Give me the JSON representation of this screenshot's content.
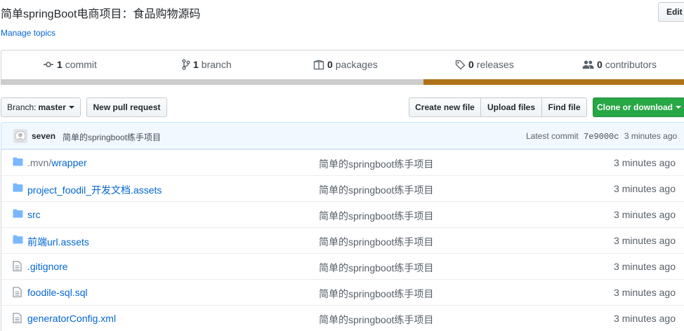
{
  "repo": {
    "description": "简单springBoot电商项目：食品购物源码",
    "manage_topics": "Manage topics",
    "edit_label": "Edit"
  },
  "summary": {
    "commits": {
      "count": "1",
      "label": "commit",
      "icon": "commit-icon"
    },
    "branches": {
      "count": "1",
      "label": "branch",
      "icon": "branch-icon"
    },
    "packages": {
      "count": "0",
      "label": "packages",
      "icon": "package-icon"
    },
    "releases": {
      "count": "0",
      "label": "releases",
      "icon": "tag-icon"
    },
    "contributors": {
      "count": "0",
      "label": "contributors",
      "icon": "people-icon"
    },
    "language_colors": [
      "#cccccc",
      "#b07219"
    ]
  },
  "toolbar": {
    "branch_prefix": "Branch:",
    "branch_name": "master",
    "new_pull_request": "New pull request",
    "create_new_file": "Create new file",
    "upload_files": "Upload files",
    "find_file": "Find file",
    "clone_or_download": "Clone or download",
    "clone_color": "#28a745"
  },
  "latest_commit": {
    "author": "seven",
    "message": "简单的springboot练手项目",
    "prefix": "Latest commit",
    "sha": "7e9000c",
    "age": "3 minutes ago"
  },
  "files": [
    {
      "type": "dir",
      "name_prefix": ".mvn/",
      "name": "wrapper",
      "message": "简单的springboot练手项目",
      "age": "3 minutes ago"
    },
    {
      "type": "dir",
      "name_prefix": "",
      "name": "project_foodil_开发文档.assets",
      "message": "简单的springboot练手项目",
      "age": "3 minutes ago"
    },
    {
      "type": "dir",
      "name_prefix": "",
      "name": "src",
      "message": "简单的springboot练手项目",
      "age": "3 minutes ago"
    },
    {
      "type": "dir",
      "name_prefix": "",
      "name": "前端url.assets",
      "message": "简单的springboot练手项目",
      "age": "3 minutes ago"
    },
    {
      "type": "file",
      "name_prefix": "",
      "name": ".gitignore",
      "message": "简单的springboot练手项目",
      "age": "3 minutes ago"
    },
    {
      "type": "file",
      "name_prefix": "",
      "name": "foodile-sql.sql",
      "message": "简单的springboot练手项目",
      "age": "3 minutes ago"
    },
    {
      "type": "file",
      "name_prefix": "",
      "name": "generatorConfig.xml",
      "message": "简单的springboot练手项目",
      "age": "3 minutes ago"
    }
  ]
}
